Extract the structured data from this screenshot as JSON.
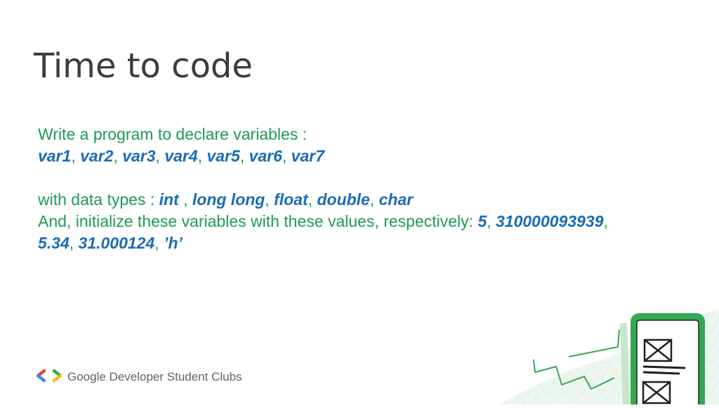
{
  "slide": {
    "title": "Time to code",
    "intro": "Write a program  to declare variables :",
    "variables": [
      "var1",
      "var2",
      "var3",
      "var4",
      "var5",
      "var6",
      "var7"
    ],
    "types_prefix": "with data types : ",
    "types": [
      "int",
      "long long",
      "float",
      "double",
      "char"
    ],
    "values_prefix": "And, initialize these variables with these values, respectively: ",
    "values_line1": [
      "5",
      "310000093939"
    ],
    "values_line2": [
      "5.34",
      "31.000124",
      "’h’"
    ]
  },
  "footer": {
    "brand": "Google Developer Student Clubs",
    "logo_icon": "gdsc-brackets-icon"
  },
  "colors": {
    "title": "#3c3c3c",
    "body_green": "#1e9a55",
    "keyword_blue": "#1a6cb5",
    "accent_green": "#34a853",
    "footer_gray": "#5f6368"
  },
  "illustration": {
    "icon": "phone-app-illustration-icon"
  }
}
